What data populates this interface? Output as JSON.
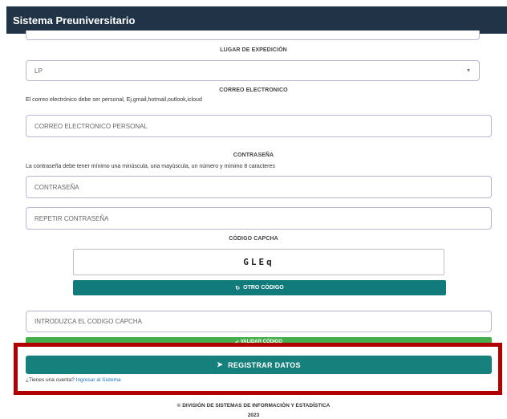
{
  "header": {
    "title": "Sistema Preuniversitario"
  },
  "lugar_expedicion": {
    "label": "LUGAR DE EXPEDICIÓN",
    "selected": "LP"
  },
  "correo": {
    "label": "CORREO ELECTRONICO",
    "hint": "El correo electrónico debe ser personal, Ej.gmail,hotmail,outlook,icloud",
    "placeholder": "CORREO ELECTRONICO PERSONAL"
  },
  "contrasena": {
    "label": "CONTRASEÑA",
    "hint": "La contraseña debe tener mínimo una minúscula, una mayúscula, un número y mínimo 8 caracteres",
    "placeholder": "CONTRASEÑA",
    "repeat_placeholder": "REPETIR CONTRASEÑA"
  },
  "captcha": {
    "label": "CÓDIGO CAPCHA",
    "code": "GLEq",
    "refresh_label": "OTRO CÓDIGO",
    "input_placeholder": "INTRODUZCA EL CODIGO CAPCHA",
    "validate_label": "VALIDAR CÓDIGO"
  },
  "register": {
    "label": "REGISTRAR DATOS"
  },
  "account": {
    "question": "¿Tienes una cuenta?",
    "link": "Ingresar al Sistema"
  },
  "footer": {
    "line1": "© DIVISIÓN DE SISTEMAS DE INFORMACIÓN Y ESTADÍSTICA",
    "line2": "2023"
  },
  "colors": {
    "topbar": "#213447",
    "teal_button": "#117a7a",
    "green_button": "#45ad4b",
    "highlight": "#b00000",
    "field_border": "#b9b6d9"
  }
}
